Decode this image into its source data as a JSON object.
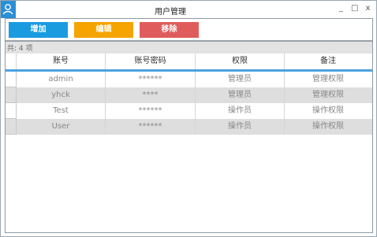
{
  "window": {
    "title": "用户管理",
    "controls": {
      "minimize": "_",
      "maximize": "□",
      "close": "x"
    },
    "icon": "user-icon",
    "accent_color": "#2b8fd6"
  },
  "toolbar": {
    "add_label": "增加",
    "edit_label": "编辑",
    "remove_label": "移除",
    "colors": {
      "add": "#1a9be0",
      "edit": "#f5a400",
      "remove": "#e05c5c"
    }
  },
  "summary": {
    "count_text": "共: 4 项"
  },
  "table": {
    "columns": [
      "账号",
      "账号密码",
      "权限",
      "备注"
    ],
    "rows": [
      {
        "account": "admin",
        "password": "******",
        "role": "管理员",
        "remark": "管理权限"
      },
      {
        "account": "yhck",
        "password": "****",
        "role": "管理员",
        "remark": "管理权限"
      },
      {
        "account": "Test",
        "password": "******",
        "role": "操作员",
        "remark": "操作权限"
      },
      {
        "account": "User",
        "password": "******",
        "role": "操作员",
        "remark": "操作权限"
      }
    ]
  }
}
